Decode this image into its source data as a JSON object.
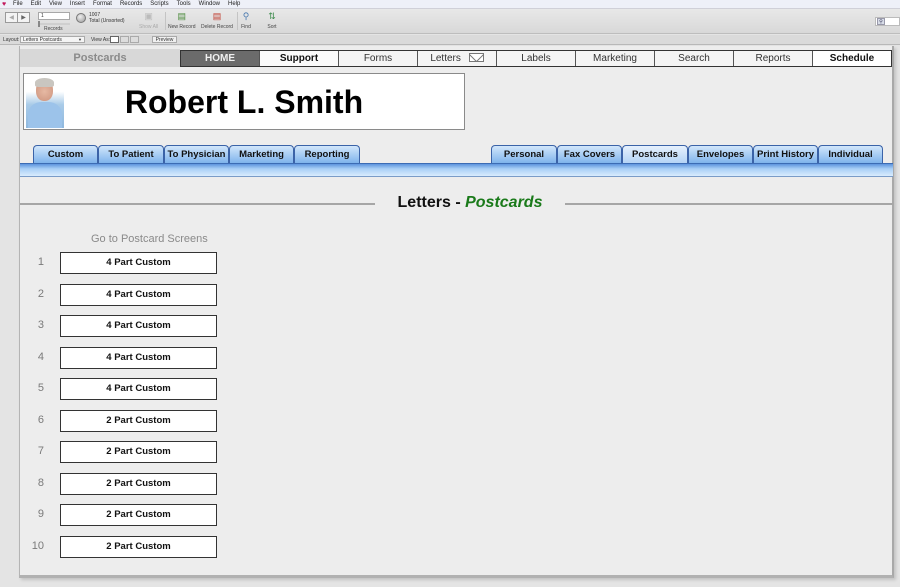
{
  "menubar": {
    "items": [
      "File",
      "Edit",
      "View",
      "Insert",
      "Format",
      "Records",
      "Scripts",
      "Tools",
      "Window",
      "Help"
    ]
  },
  "toolbar": {
    "record_number": "1",
    "records_label": "Records",
    "total_count": "1007",
    "total_status": "Total (Unsorted)",
    "show_all": "Show All",
    "new_record": "New Record",
    "delete_record": "Delete Record",
    "find": "Find",
    "sort": "Sort"
  },
  "layoutbar": {
    "layout_label": "Layout:",
    "layout_value": "Letters Postcards",
    "view_as_label": "View As:",
    "preview": "Preview"
  },
  "topnav": {
    "section_title": "Postcards",
    "tabs": [
      {
        "label": "HOME"
      },
      {
        "label": "Support"
      },
      {
        "label": "Forms"
      },
      {
        "label": "Letters"
      },
      {
        "label": "Labels"
      },
      {
        "label": "Marketing"
      },
      {
        "label": "Search"
      },
      {
        "label": "Reports"
      },
      {
        "label": "Schedule"
      }
    ]
  },
  "patient": {
    "name": "Robert L. Smith"
  },
  "subtabs_left": [
    {
      "label": "Custom"
    },
    {
      "label": "To Patient"
    },
    {
      "label": "To Physician"
    },
    {
      "label": "Marketing"
    },
    {
      "label": "Reporting"
    }
  ],
  "subtabs_right": [
    {
      "label": "Personal"
    },
    {
      "label": "Fax Covers"
    },
    {
      "label": "Postcards"
    },
    {
      "label": "Envelopes"
    },
    {
      "label": "Print History"
    },
    {
      "label": "Individual"
    }
  ],
  "heading": {
    "main": "Letters - ",
    "sub": "Postcards"
  },
  "postcards": {
    "title": "Go to Postcard Screens",
    "items": [
      {
        "num": "1",
        "label": "4 Part Custom"
      },
      {
        "num": "2",
        "label": "4 Part Custom"
      },
      {
        "num": "3",
        "label": "4 Part Custom"
      },
      {
        "num": "4",
        "label": "4 Part Custom"
      },
      {
        "num": "5",
        "label": "4 Part Custom"
      },
      {
        "num": "6",
        "label": "2 Part Custom"
      },
      {
        "num": "7",
        "label": "2 Part Custom"
      },
      {
        "num": "8",
        "label": "2 Part Custom"
      },
      {
        "num": "9",
        "label": "2 Part Custom"
      },
      {
        "num": "10",
        "label": "2 Part Custom"
      }
    ]
  }
}
